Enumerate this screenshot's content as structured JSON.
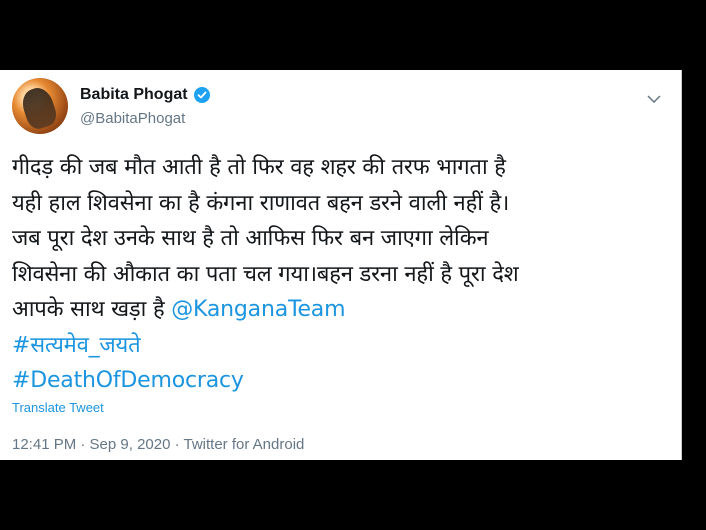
{
  "tweet": {
    "author_name": "Babita Phogat",
    "handle": "@BabitaPhogat",
    "lines": [
      "गीदड़ की जब मौत आती है तो फिर वह शहर की तरफ भागता है",
      "यही हाल शिवसेना का है कंगना राणावत बहन डरने वाली नहीं है।",
      "जब पूरा देश उनके साथ है तो आफिस फिर बन जाएगा लेकिन",
      "शिवसेना की औकात का पता चल गया।बहन डरना नहीं है पूरा देश"
    ],
    "line5_text": "आपके साथ खड़ा है ",
    "mention": "@KanganaTeam",
    "hashtags": [
      "#सत्यमेव_जयते",
      "#DeathOfDemocracy"
    ],
    "translate_label": "Translate Tweet",
    "timestamp": "12:41 PM · Sep 9, 2020 · Twitter for Android"
  },
  "icons": {
    "verified": "verified-badge-icon",
    "menu": "chevron-down-icon"
  },
  "colors": {
    "link": "#1b95e0",
    "verified": "#1da1f2",
    "text": "#14171a",
    "muted": "#657786",
    "background_letterbox": "#000000"
  }
}
